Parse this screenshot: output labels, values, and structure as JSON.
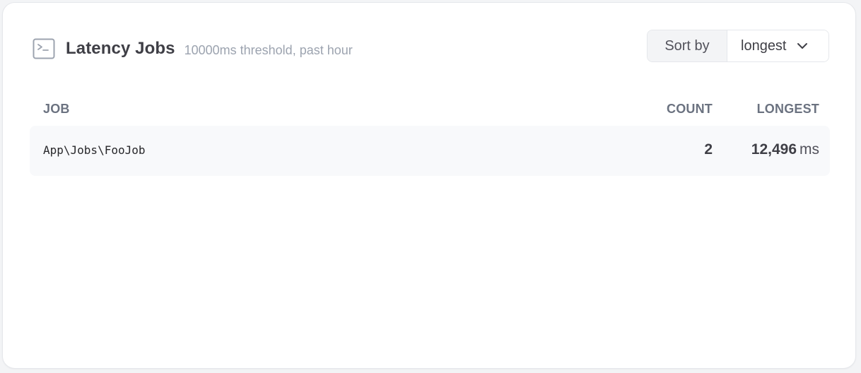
{
  "card": {
    "title": "Latency Jobs",
    "subtitle": "10000ms threshold, past hour",
    "icon": "terminal-icon"
  },
  "sort": {
    "label": "Sort by",
    "selected": "longest",
    "icon": "chevron-down-icon"
  },
  "table": {
    "columns": {
      "job": "JOB",
      "count": "COUNT",
      "longest": "LONGEST"
    },
    "rows": [
      {
        "job": "App\\Jobs\\FooJob",
        "count": "2",
        "longest_value": "12,496",
        "longest_unit": "ms"
      }
    ]
  },
  "colors": {
    "title": "#3f3f46",
    "subtitle": "#9ca3af",
    "row_background": "#f8f9fb",
    "border": "#e5e7eb"
  }
}
